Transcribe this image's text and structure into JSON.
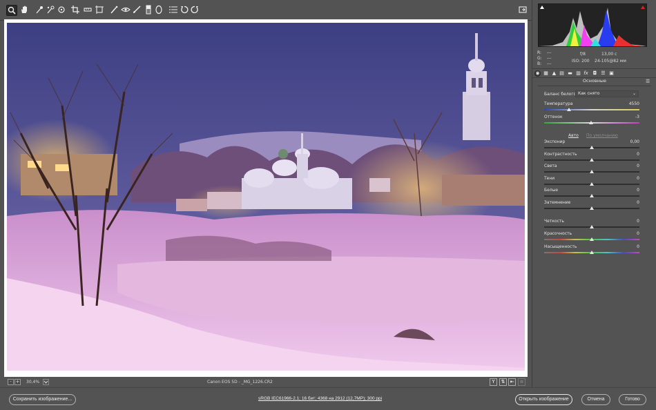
{
  "toolbar": {
    "tools": [
      "zoom-icon",
      "hand-icon",
      "white-balance-icon",
      "color-sampler-icon",
      "target-adjust-icon",
      "crop-icon",
      "straighten-icon",
      "transform-icon",
      "spot-removal-icon",
      "red-eye-icon",
      "adjustment-brush-icon",
      "graduated-filter-icon",
      "radial-filter-icon",
      "presets-icon",
      "rotate-left-icon",
      "rotate-right-icon"
    ],
    "fullscreen_icon": "fullscreen-icon"
  },
  "status": {
    "zoom": "30,4%",
    "camera_file": "Canon EOS 5D  -  _MG_1226.CR2",
    "zoom_out": "-",
    "zoom_in": "+",
    "view_y": "Y"
  },
  "bottom": {
    "save_label": "Сохранить изображение...",
    "workflow": "sRGB IEC61966-2.1; 16 бит; 4368 на 2912 (12,7МР); 300 ppi",
    "open_label": "Открыть изображение",
    "cancel_label": "Отмена",
    "done_label": "Готово"
  },
  "info": {
    "r_label": "R:",
    "g_label": "G:",
    "b_label": "B:",
    "r_val": "---",
    "g_val": "---",
    "b_val": "---",
    "aperture": "f/8",
    "shutter": "13,00 с",
    "iso": "ISO: 200",
    "lens": "24-105@82 мм"
  },
  "panel": {
    "section_title": "Основные",
    "wb_label": "Баланс белого:",
    "wb_value": "Как снято",
    "auto_label": "Авто",
    "default_label": "По умолчанию"
  },
  "sliders": [
    {
      "label": "Температура",
      "value": "4550",
      "position": 0.26
    },
    {
      "label": "Оттенок",
      "value": "-3",
      "position": 0.49
    },
    {
      "label": "Экспонир",
      "value": "0,00",
      "position": 0.5
    },
    {
      "label": "Контрастность",
      "value": "0",
      "position": 0.5
    },
    {
      "label": "Света",
      "value": "0",
      "position": 0.5
    },
    {
      "label": "Тени",
      "value": "0",
      "position": 0.5
    },
    {
      "label": "Белые",
      "value": "0",
      "position": 0.5
    },
    {
      "label": "Затемнение",
      "value": "0",
      "position": 0.5
    },
    {
      "label": "Четкость",
      "value": "0",
      "position": 0.5
    },
    {
      "label": "Красочность",
      "value": "0",
      "position": 0.5
    },
    {
      "label": "Насыщенность",
      "value": "0",
      "position": 0.5
    }
  ],
  "colors": {
    "background": "#535353",
    "accent_clip_shadow": "#ffffff",
    "accent_clip_highlight": "#e02020"
  }
}
